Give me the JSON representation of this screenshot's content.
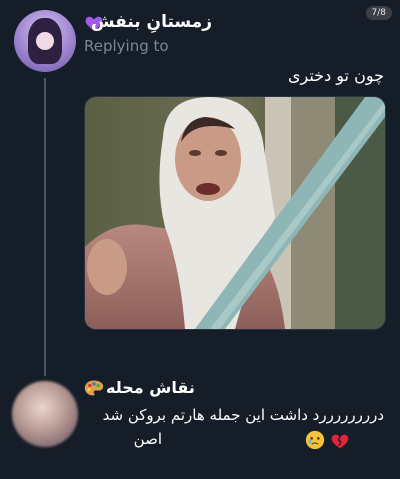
{
  "viewer": {
    "page_counter": "7/8"
  },
  "tweet": {
    "author_name": "زمستانِ بنفش",
    "author_emoji": "purple-heart-icon",
    "replying_label": "Replying to",
    "text": "چون تو دختری",
    "media_icon": "crying-woman-photo"
  },
  "reply": {
    "author_name": "نقاش محله",
    "author_emoji": "artist-palette-icon",
    "text_line_1": "دررررررررد داشت این جمله هارتم بروکن شد",
    "text_line_2": "اصن",
    "emojis": [
      "broken-heart-icon",
      "face-holding-back-tears-icon"
    ]
  },
  "colors": {
    "background": "#151d28",
    "muted_text": "#7a8696",
    "thread_line": "#4a5563",
    "heart": "#a25be8",
    "broken_heart": "#e0243b"
  }
}
